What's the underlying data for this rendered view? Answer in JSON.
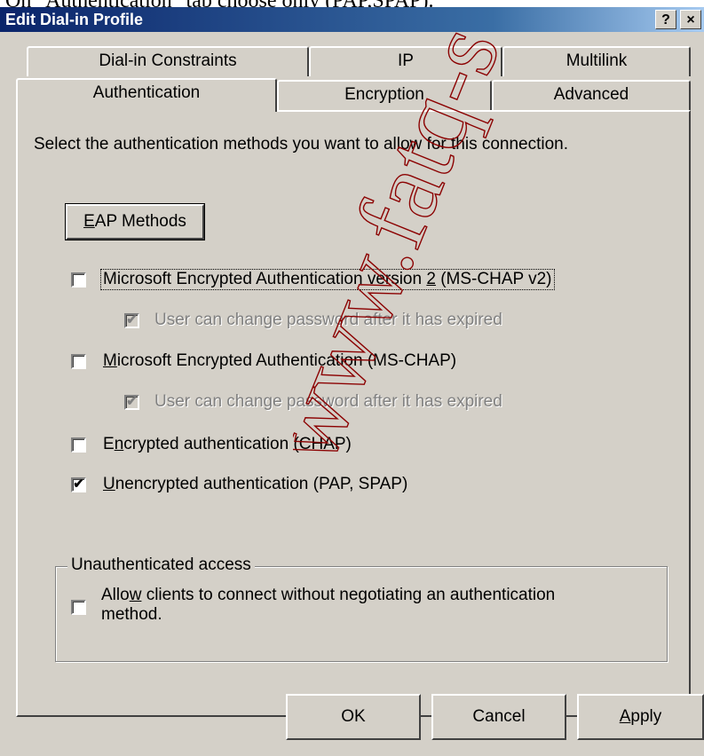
{
  "caption": "On \"Authentication\" tab choose only (PAP,SPAP).",
  "window": {
    "title": "Edit Dial-in Profile",
    "help_label": "?",
    "close_label": "×"
  },
  "tabs_back": [
    {
      "label": "Dial-in Constraints"
    },
    {
      "label": "IP"
    },
    {
      "label": "Multilink"
    }
  ],
  "tabs_front": [
    {
      "label": "Authentication",
      "active": true
    },
    {
      "label": "Encryption"
    },
    {
      "label": "Advanced"
    }
  ],
  "panel": {
    "instruction": "Select the authentication methods you want to allow for this connection.",
    "eap_button": {
      "hotkey": "E",
      "rest": "AP Methods"
    },
    "options": [
      {
        "pre": "Microsoft Encrypted Authentication version ",
        "hotkey": "2",
        "post": " (MS-CHAP v2)",
        "checked": false
      },
      {
        "text": "User can change password after it has expired",
        "checked": true,
        "disabled": true
      },
      {
        "pre": "",
        "hotkey": "M",
        "post": "icrosoft Encrypted Authentication (MS-CHAP)",
        "checked": false
      },
      {
        "text": "User can change password after it has expired",
        "checked": true,
        "disabled": true
      },
      {
        "pre": "E",
        "hotkey": "n",
        "post": "crypted authentication (CHAP)",
        "checked": false
      },
      {
        "pre": "",
        "hotkey": "U",
        "post": "nencrypted authentication (PAP, SPAP)",
        "checked": true
      }
    ],
    "group": {
      "legend": "Unauthenticated access",
      "option": {
        "pre": "Allo",
        "hotkey": "w",
        "post": " clients to connect without negotiating an authentication",
        "line2": "method.",
        "checked": false
      }
    }
  },
  "footer": {
    "ok": "OK",
    "cancel": "Cancel",
    "apply": {
      "hotkey": "A",
      "rest": "pply"
    }
  },
  "watermark": "www.fatq-s",
  "check_glyph": "✔"
}
